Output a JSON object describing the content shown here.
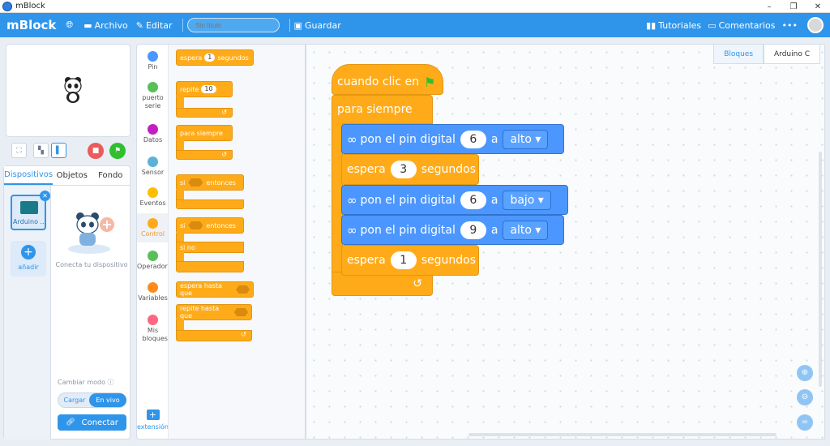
{
  "window": {
    "title": "mBlock",
    "minimize": "–",
    "maximize": "❐",
    "close": "✕"
  },
  "topbar": {
    "logo": "mBlock",
    "file": "Archivo",
    "edit": "Editar",
    "project_title_placeholder": "Sin título",
    "save": "Guardar",
    "tutorials": "Tutoriales",
    "comments": "Comentarios",
    "more": "•••"
  },
  "left_panel": {
    "tabs": [
      "Dispositivos",
      "Objetos",
      "Fondo"
    ],
    "device_name": "Arduino ...",
    "add_label": "añadir",
    "connect_hint": "Conecta tu dispositivo",
    "mode_label": "Cambiar modo",
    "mode_upload": "Cargar",
    "mode_live": "En vivo",
    "connect_button": "Conectar"
  },
  "categories": [
    {
      "label": "Pin",
      "color": "#4c97ff"
    },
    {
      "label": "puerto serie",
      "color": "#59c059"
    },
    {
      "label": "Datos",
      "color": "#c21fc2"
    },
    {
      "label": "Sensor",
      "color": "#5cb1d6"
    },
    {
      "label": "Eventos",
      "color": "#ffbf00"
    },
    {
      "label": "Control",
      "color": "#ffab19"
    },
    {
      "label": "Operadores",
      "color": "#59c059"
    },
    {
      "label": "Variables",
      "color": "#ff8c1a"
    },
    {
      "label": "Mis bloques",
      "color": "#ff6680"
    }
  ],
  "extension_label": "extensión",
  "palette": {
    "wait": "espera",
    "wait_value": "1",
    "seconds": "segundos",
    "repeat": "repite",
    "repeat_value": "10",
    "forever": "para siempre",
    "if": "si",
    "then": "entonces",
    "if2": "si",
    "then2": "entonces",
    "else": "si no",
    "wait_until": "espera hasta que",
    "repeat_until": "repite hasta que"
  },
  "workspace": {
    "tabs": [
      "Bloques",
      "Arduino C"
    ],
    "script": {
      "hat": "cuando clic en",
      "forever": "para siempre",
      "set_pin": "pon el pin digital",
      "to": "a",
      "wait": "espera",
      "seconds": "segundos",
      "steps": [
        {
          "pin": "6",
          "level": "alto"
        },
        {
          "wait": "3"
        },
        {
          "pin": "6",
          "level": "bajo"
        },
        {
          "pin": "9",
          "level": "alto"
        },
        {
          "wait": "1"
        }
      ]
    }
  },
  "colors": {
    "accent": "#2f95ea",
    "control": "#ffab19",
    "arduino": "#4c97ff",
    "green_flag": "#2fbf2f",
    "stop": "#ec5a5a"
  }
}
